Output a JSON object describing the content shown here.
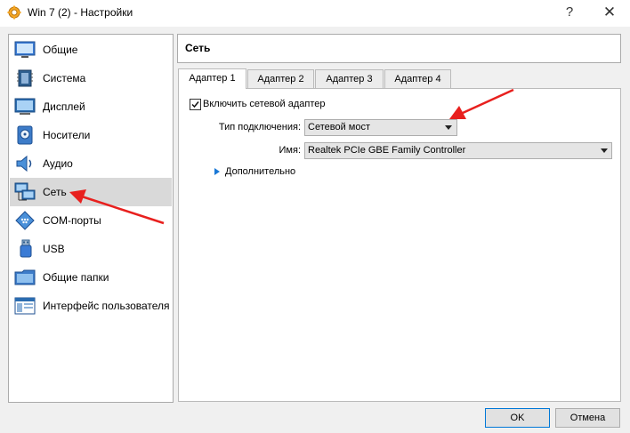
{
  "window": {
    "title": "Win 7 (2) - Настройки",
    "help_label": "?",
    "close_label": "✕"
  },
  "sidebar": {
    "items": [
      {
        "label": "Общие",
        "icon": "general-icon",
        "active": false
      },
      {
        "label": "Система",
        "icon": "system-icon",
        "active": false
      },
      {
        "label": "Дисплей",
        "icon": "display-icon",
        "active": false
      },
      {
        "label": "Носители",
        "icon": "storage-icon",
        "active": false
      },
      {
        "label": "Аудио",
        "icon": "audio-icon",
        "active": false
      },
      {
        "label": "Сеть",
        "icon": "network-icon",
        "active": true
      },
      {
        "label": "COM-порты",
        "icon": "serial-port-icon",
        "active": false
      },
      {
        "label": "USB",
        "icon": "usb-icon",
        "active": false
      },
      {
        "label": "Общие папки",
        "icon": "shared-folder-icon",
        "active": false
      },
      {
        "label": "Интерфейс пользователя",
        "icon": "user-interface-icon",
        "active": false
      }
    ]
  },
  "main": {
    "section_title": "Сеть",
    "tabs": [
      {
        "label": "Адаптер 1",
        "active": true
      },
      {
        "label": "Адаптер 2",
        "active": false
      },
      {
        "label": "Адаптер 3",
        "active": false
      },
      {
        "label": "Адаптер 4",
        "active": false
      }
    ],
    "enable_adapter": {
      "label": "Включить сетевой адаптер",
      "checked": true
    },
    "attachment": {
      "label": "Тип подключения:",
      "value": "Сетевой мост"
    },
    "name": {
      "label": "Имя:",
      "value": "Realtek PCIe GBE Family Controller"
    },
    "advanced_label": "Дополнительно"
  },
  "footer": {
    "ok_label": "OK",
    "cancel_label": "Отмена"
  },
  "colors": {
    "accent": "#0078d7",
    "annotation_arrow": "#e8201e",
    "selected_bg": "#d9d9d9"
  }
}
